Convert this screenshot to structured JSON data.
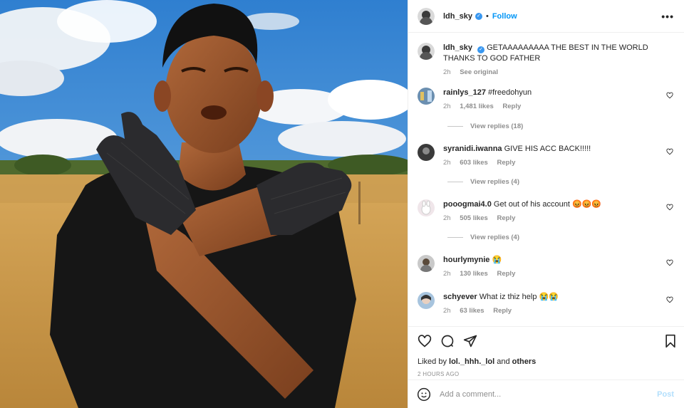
{
  "post": {
    "username": "ldh_sky",
    "separator": "•",
    "follow_label": "Follow",
    "more_label": "•••",
    "verified_mark": "✓",
    "caption": "GETAAAAAAAAA THE BEST IN THE WORLD THANKS TO GOD FATHER",
    "caption_time": "2h",
    "see_original_label": "See original"
  },
  "comments": [
    {
      "user": "rainlys_127",
      "text": "#freedohyun",
      "time": "2h",
      "likes": "1,481 likes",
      "reply_label": "Reply",
      "view_replies": "View replies (18)"
    },
    {
      "user": "syranidi.iwanna",
      "text": "GIVE HIS ACC BACK!!!!!",
      "time": "2h",
      "likes": "603 likes",
      "reply_label": "Reply",
      "view_replies": "View replies (4)"
    },
    {
      "user": "pooogmai4.0",
      "text": "Get out of his account 😡😡😡",
      "time": "2h",
      "likes": "505 likes",
      "reply_label": "Reply",
      "view_replies": "View replies (4)"
    },
    {
      "user": "hourlymynie",
      "text": "😭",
      "time": "2h",
      "likes": "130 likes",
      "reply_label": "Reply"
    },
    {
      "user": "schyever",
      "text": "What iz thiz help 😭😭",
      "time": "2h",
      "likes": "63 likes",
      "reply_label": "Reply"
    }
  ],
  "likes": {
    "prefix": "Liked by ",
    "user": "lol._hhh._lol",
    "middle": " and ",
    "others": "others"
  },
  "posted_ago": "2 HOURS AGO",
  "add_comment": {
    "placeholder": "Add a comment...",
    "post_label": "Post"
  },
  "icons": {
    "verified": "verified-badge-icon",
    "more": "more-options-icon",
    "heart": "heart-icon",
    "comment": "comment-icon",
    "share": "share-icon",
    "save": "bookmark-icon",
    "emoji": "emoji-icon"
  },
  "colors": {
    "accent": "#0095f6",
    "muted": "#8e8e8e",
    "post_disabled": "#b2dffc",
    "verified": "#3897f0"
  }
}
